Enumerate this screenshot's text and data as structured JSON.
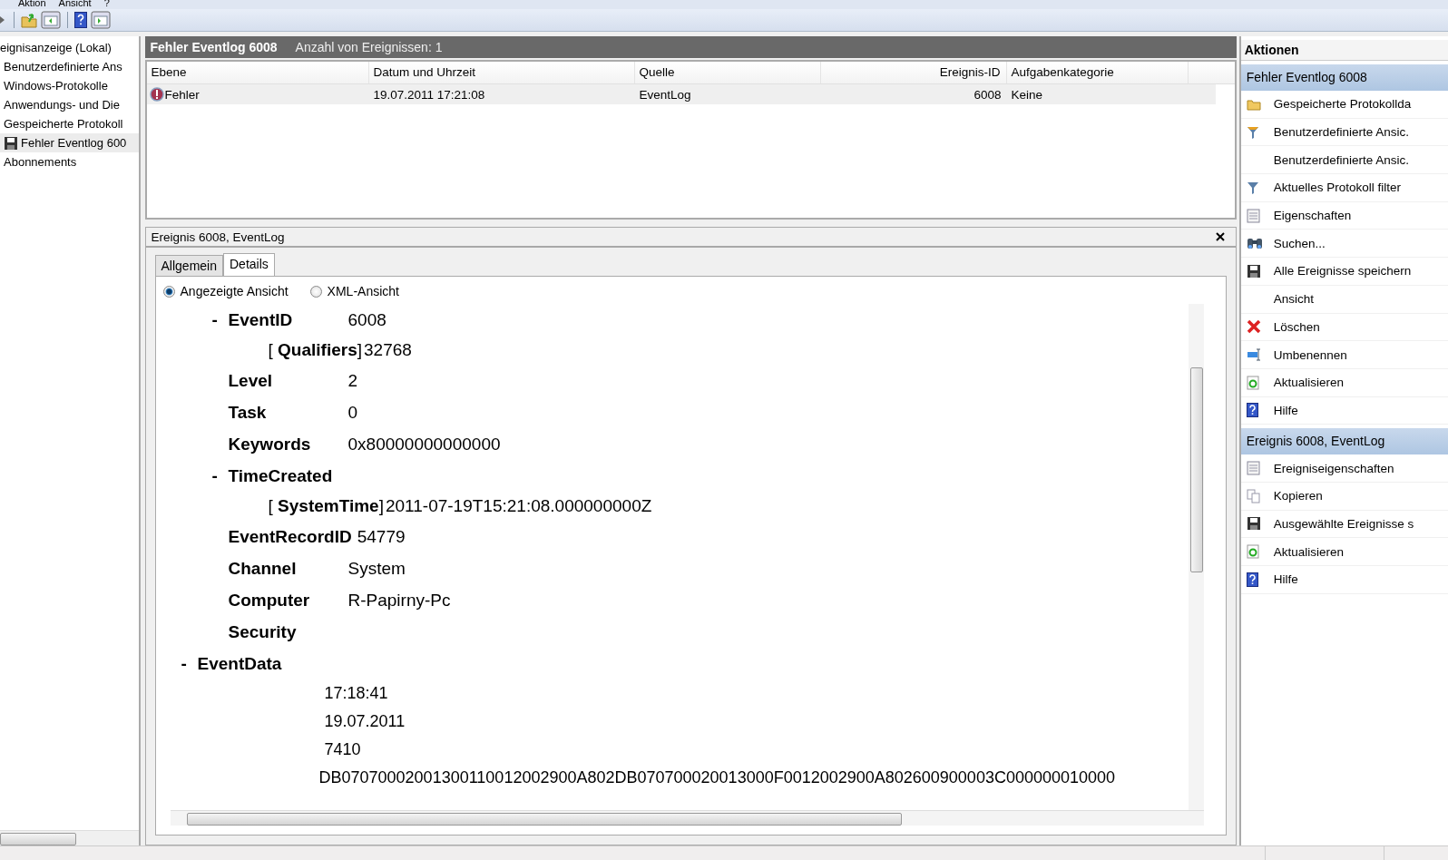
{
  "menu": [
    "Aktion",
    "Ansicht",
    "?"
  ],
  "tree": [
    {
      "label": "eignisanzeige (Lokal)",
      "selected": false,
      "children": [
        {
          "label": "Benutzerdefinierte Ans",
          "selected": false
        },
        {
          "label": "Windows-Protokolle",
          "selected": false
        },
        {
          "label": "Anwendungs- und Die",
          "selected": false
        },
        {
          "label": "Gespeicherte Protokoll",
          "selected": false
        },
        {
          "label": "Fehler Eventlog 600",
          "selected": true,
          "kind": "saved"
        },
        {
          "label": "Abonnements",
          "selected": false
        }
      ]
    }
  ],
  "log_header": {
    "title": "Fehler Eventlog 6008",
    "count": "Anzahl von Ereignissen: 1"
  },
  "table": {
    "columns": [
      "Ebene",
      "Datum und Uhrzeit",
      "Quelle",
      "Ereignis-ID",
      "Aufgabenkategorie"
    ],
    "rows": [
      {
        "selected": true,
        "cells": [
          "Fehler",
          "19.07.2011 17:21:08",
          "EventLog",
          "6008",
          "Keine"
        ]
      }
    ]
  },
  "detail": {
    "title": "Ereignis 6008, EventLog",
    "tabs": [
      {
        "label": "Allgemein",
        "selected": false
      },
      {
        "label": "Details",
        "selected": true
      }
    ],
    "views": [
      {
        "label": "Angezeigte Ansicht",
        "selected": true
      },
      {
        "label": "XML-Ansicht",
        "selected": false
      }
    ],
    "xml_tree": [
      {
        "children": [
          {
            "name": "EventID",
            "value": "6008",
            "toggle": "-",
            "children": [
              {
                "kind": "attr",
                "name": "[ **Qualifiers**]",
                "value": "32768"
              }
            ]
          },
          {
            "name": "Level",
            "value": "2"
          },
          {
            "name": "Task",
            "value": "0"
          },
          {
            "name": "Keywords",
            "value": "0x80000000000000"
          },
          {
            "name": "TimeCreated",
            "toggle": "-",
            "children": [
              {
                "kind": "attr",
                "name": "[ **SystemTime**]",
                "value": "2011-07-19T15:21:08.000000000Z"
              }
            ]
          },
          {
            "name": "EventRecordID",
            "value": "54779",
            "kind": "tight"
          },
          {
            "name": "Channel",
            "value": "System"
          },
          {
            "name": "Computer",
            "value": "R-Papirny-Pc"
          },
          {
            "name": "Security"
          }
        ]
      },
      {
        "name": "EventData",
        "toggle": "-",
        "children": [
          {
            "kind": "data",
            "value": "17:18:41"
          },
          {
            "kind": "data",
            "value": "19.07.2011"
          },
          {
            "kind": "data",
            "value": "7410"
          },
          {
            "kind": "data",
            "value": "DB07070002001300110012002900A802DB070700020013000F0012002900A802600900003C000000010000"
          }
        ]
      }
    ]
  },
  "actions": {
    "title": "Aktionen",
    "sections": [
      {
        "title": "Fehler Eventlog 6008",
        "items": [
          "Gespeicherte Protokollda",
          "Benutzerdefinierte Ansic.",
          "Benutzerdefinierte Ansic.",
          "Aktuelles Protokoll filter",
          "Eigenschaften",
          "Suchen...",
          "Alle Ereignisse speichern",
          "Ansicht",
          "Löschen",
          "Umbenennen",
          "Aktualisieren",
          "Hilfe"
        ]
      },
      {
        "title": "Ereignis 6008, EventLog",
        "items": [
          "Ereigniseigenschaften",
          "Kopieren",
          "Ausgewählte Ereignisse s",
          "Aktualisieren",
          "Hilfe"
        ]
      }
    ]
  }
}
